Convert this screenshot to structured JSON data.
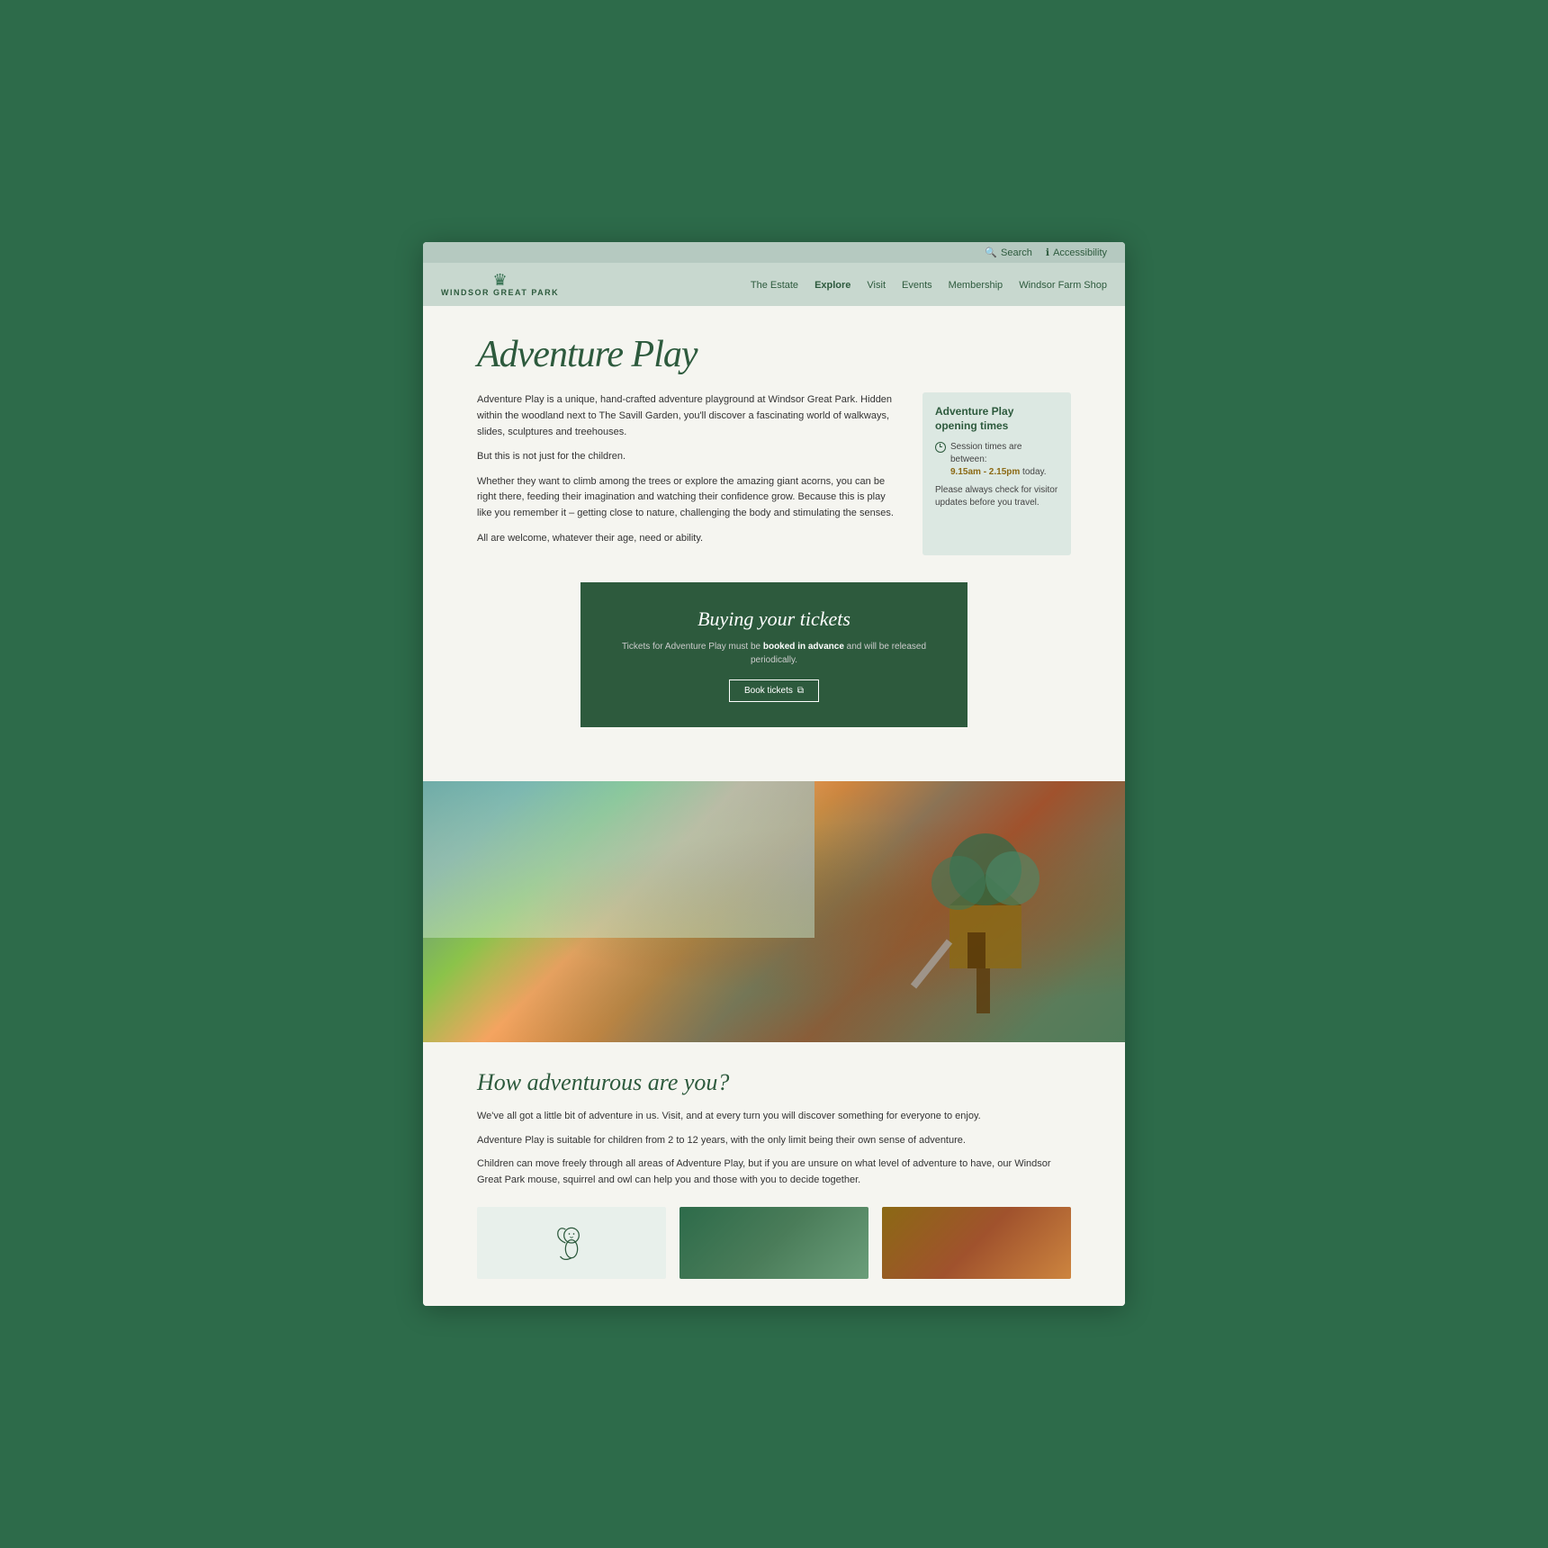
{
  "utility_bar": {
    "search_label": "Search",
    "accessibility_label": "Accessibility"
  },
  "nav": {
    "logo_line1": "WINDSOR",
    "logo_line2": "GREAT PARK",
    "links": [
      {
        "label": "The Estate",
        "active": false
      },
      {
        "label": "Explore",
        "active": true
      },
      {
        "label": "Visit",
        "active": false
      },
      {
        "label": "Events",
        "active": false
      },
      {
        "label": "Membership",
        "active": false
      },
      {
        "label": "Windsor Farm Shop",
        "active": false
      }
    ]
  },
  "page": {
    "title": "Adventure Play",
    "intro_p1": "Adventure Play is a unique, hand-crafted adventure playground at Windsor Great Park. Hidden within the woodland next to The Savill Garden, you'll discover a fascinating world of walkways, slides, sculptures and treehouses.",
    "intro_p2": "But this is not just for the children.",
    "intro_p3": "Whether they want to climb among the trees or explore the amazing giant acorns, you can be right there, feeding their imagination and watching their confidence grow. Because this is play like you remember it – getting close to nature, challenging the body and stimulating the senses.",
    "intro_p4": "All are welcome, whatever their age, need or ability.",
    "sidebar": {
      "title": "Adventure Play opening times",
      "session_label": "Session times are between:",
      "time_highlight": "9.15am - 2.15pm",
      "time_suffix": " today.",
      "update_text": "Please always check for visitor updates before you travel."
    },
    "tickets": {
      "heading": "Buying your tickets",
      "description_prefix": "Tickets for Adventure Play must be ",
      "description_bold": "booked in advance",
      "description_suffix": " and will be released periodically.",
      "button_label": "Book tickets"
    },
    "adventurous": {
      "heading": "How adventurous are you?",
      "p1": "We've all got a little bit of adventure in us. Visit, and at every turn you will discover something for everyone to enjoy.",
      "p2": "Adventure Play is suitable for children from 2 to 12 years, with the only limit being their own sense of adventure.",
      "p3": "Children can move freely through all areas of Adventure Play, but if you are unsure on what level of adventure to have, our Windsor Great Park mouse, squirrel and owl can help you and those with you to decide together."
    }
  }
}
